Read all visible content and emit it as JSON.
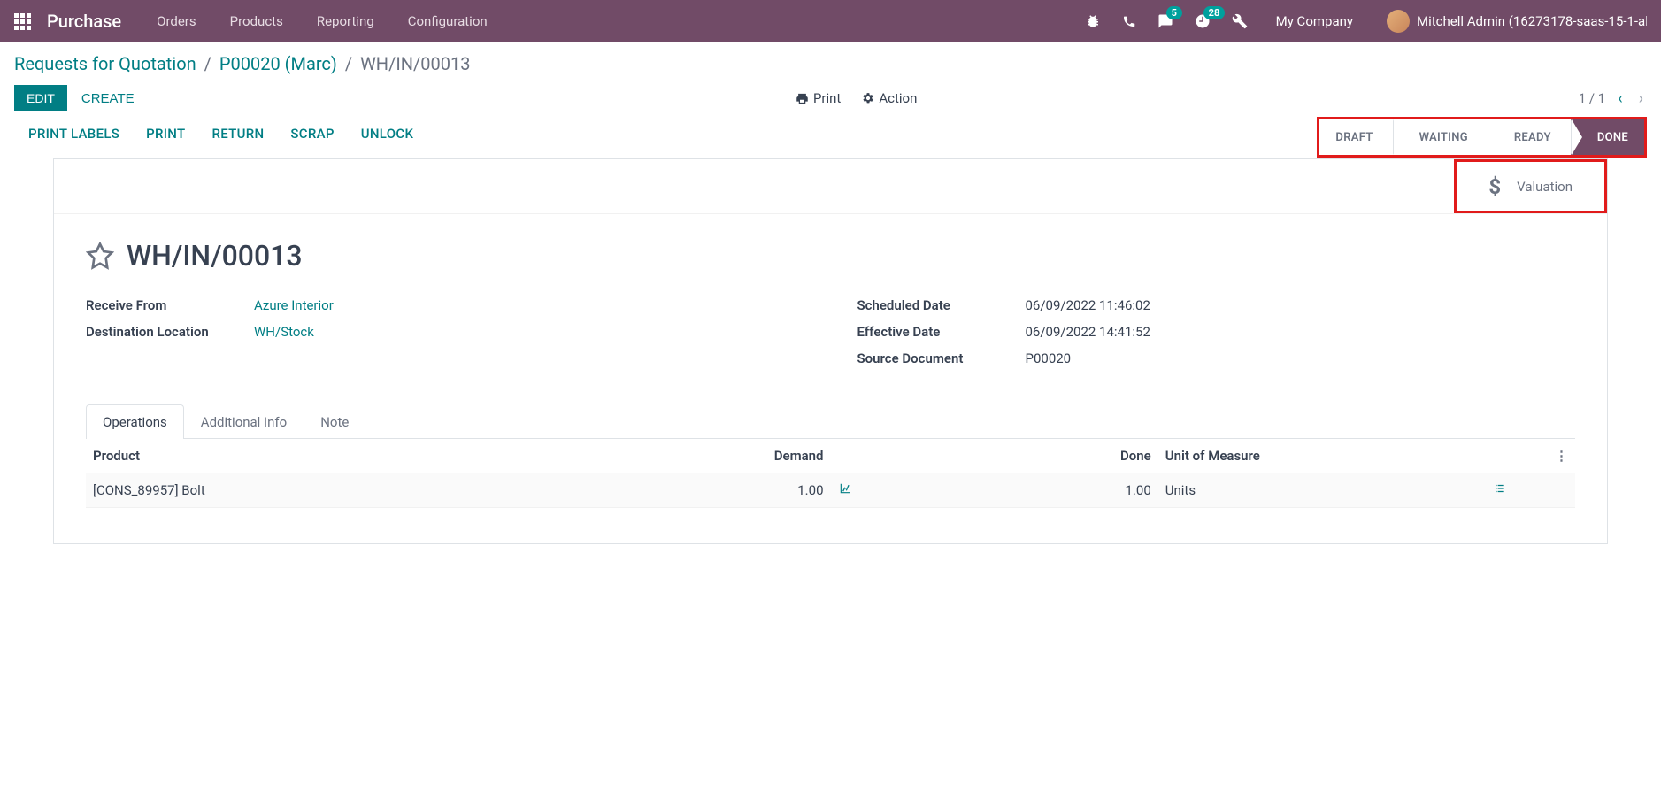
{
  "navbar": {
    "brand": "Purchase",
    "menu": [
      "Orders",
      "Products",
      "Reporting",
      "Configuration"
    ],
    "messaging_badge": "5",
    "activities_badge": "28",
    "company": "My Company",
    "username": "Mitchell Admin (16273178-saas-15-1-al"
  },
  "breadcrumb": {
    "root": "Requests for Quotation",
    "parent": "P00020 (Marc)",
    "current": "WH/IN/00013"
  },
  "buttons": {
    "edit": "EDIT",
    "create": "CREATE",
    "print_dropdown": "Print",
    "action_dropdown": "Action"
  },
  "pager": {
    "text": "1 / 1"
  },
  "action_bar": [
    "PRINT LABELS",
    "PRINT",
    "RETURN",
    "SCRAP",
    "UNLOCK"
  ],
  "statusbar": {
    "steps": [
      "DRAFT",
      "WAITING",
      "READY",
      "DONE"
    ],
    "active": "DONE"
  },
  "stat_button": {
    "label": "Valuation"
  },
  "record": {
    "title": "WH/IN/00013",
    "fields_left": [
      {
        "label": "Receive From",
        "value": "Azure Interior",
        "link": true
      },
      {
        "label": "Destination Location",
        "value": "WH/Stock",
        "link": true
      }
    ],
    "fields_right": [
      {
        "label": "Scheduled Date",
        "value": "06/09/2022 11:46:02"
      },
      {
        "label": "Effective Date",
        "value": "06/09/2022 14:41:52"
      },
      {
        "label": "Source Document",
        "value": "P00020"
      }
    ]
  },
  "tabs": [
    "Operations",
    "Additional Info",
    "Note"
  ],
  "table": {
    "headers": {
      "product": "Product",
      "demand": "Demand",
      "done": "Done",
      "uom": "Unit of Measure"
    },
    "rows": [
      {
        "product": "[CONS_89957] Bolt",
        "demand": "1.00",
        "done": "1.00",
        "uom": "Units"
      }
    ]
  }
}
